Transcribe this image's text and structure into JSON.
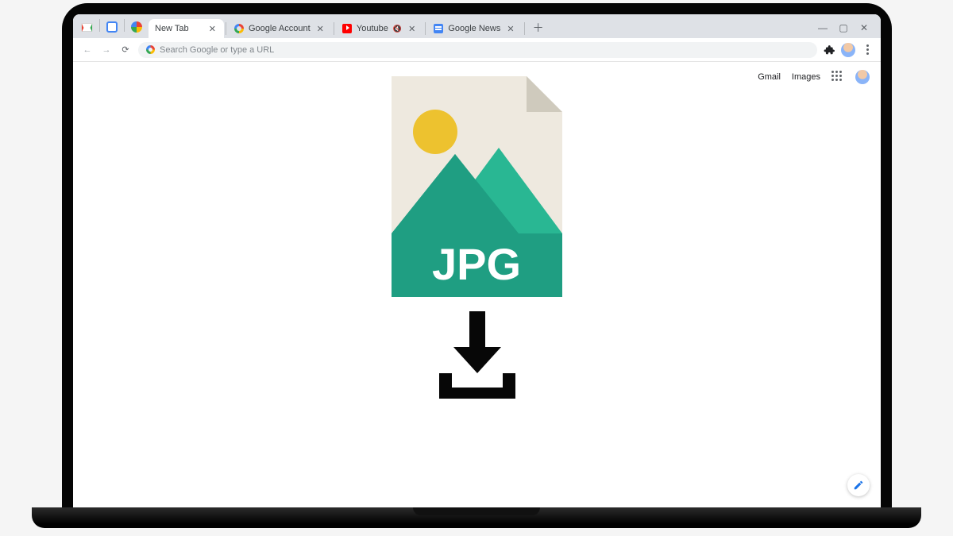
{
  "tabs": {
    "pinned": [
      "gmail-icon",
      "calendar-icon",
      "photos-icon"
    ],
    "open": [
      {
        "label": "New Tab",
        "icon": "newtab-favicon",
        "active": true,
        "muted": false
      },
      {
        "label": "Google Account",
        "icon": "google-favicon",
        "active": false,
        "muted": false
      },
      {
        "label": "Youtube",
        "icon": "youtube-favicon",
        "active": false,
        "muted": true
      },
      {
        "label": "Google News",
        "icon": "news-favicon",
        "active": false,
        "muted": false
      }
    ]
  },
  "toolbar": {
    "search_placeholder": "Search Google or type a URL"
  },
  "page": {
    "links": {
      "gmail": "Gmail",
      "images": "Images"
    },
    "file_label": "JPG"
  },
  "colors": {
    "teal_dark": "#1f9e82",
    "teal_light": "#29b793",
    "paper": "#eee9df",
    "fold": "#cfcabd",
    "sun": "#edc22f"
  }
}
